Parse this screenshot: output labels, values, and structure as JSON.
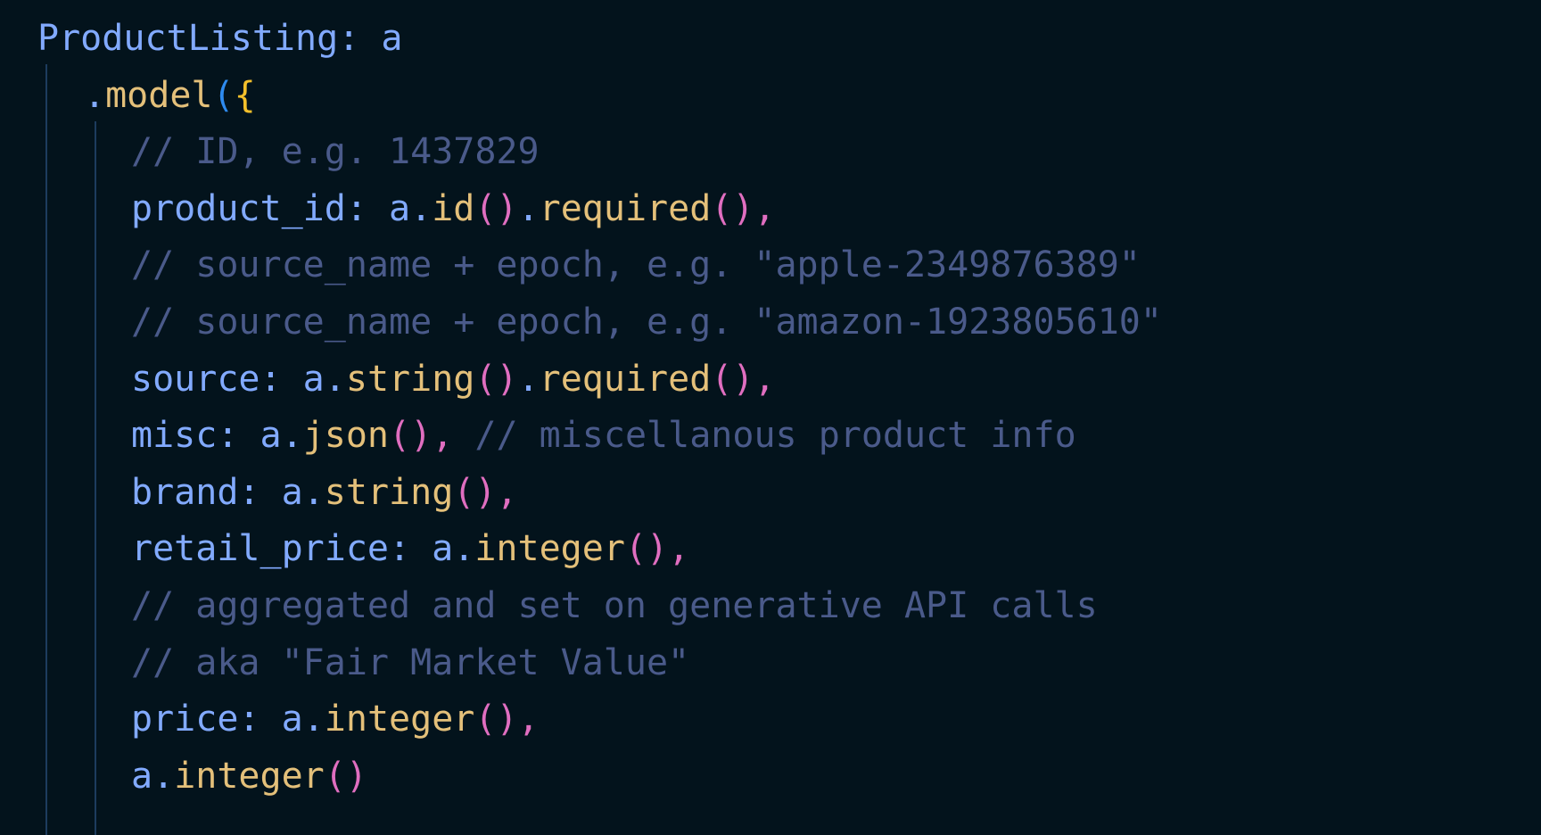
{
  "editor": {
    "language": "typescript",
    "theme_name": "dark-midnight",
    "background_color": "#03131c",
    "indent_guide_color": "#1d3c5e",
    "font_size_px": 40
  },
  "colors": {
    "identifier": "#82aaff",
    "method": "#e4c07a",
    "paren_depth1": "#e06ec0",
    "paren_depth0": "#2e8bf0",
    "brace": "#f5c02b",
    "comment": "#4a5a8a"
  },
  "code": {
    "lines": [
      {
        "indent": 0,
        "tokens": [
          {
            "t": "ProductListing",
            "c": "ident"
          },
          {
            "t": ": ",
            "c": "punct"
          },
          {
            "t": "a",
            "c": "ident"
          }
        ]
      },
      {
        "indent": 1,
        "tokens": [
          {
            "t": ".",
            "c": "dot"
          },
          {
            "t": "model",
            "c": "method"
          },
          {
            "t": "(",
            "c": "paren2"
          },
          {
            "t": "{",
            "c": "brace"
          }
        ]
      },
      {
        "indent": 2,
        "tokens": [
          {
            "t": "// ID, e.g. 1437829",
            "c": "comment"
          }
        ]
      },
      {
        "indent": 2,
        "tokens": [
          {
            "t": "product_id",
            "c": "ident"
          },
          {
            "t": ": ",
            "c": "punct"
          },
          {
            "t": "a",
            "c": "ident"
          },
          {
            "t": ".",
            "c": "dot"
          },
          {
            "t": "id",
            "c": "method"
          },
          {
            "t": "()",
            "c": "paren"
          },
          {
            "t": ".",
            "c": "dot"
          },
          {
            "t": "required",
            "c": "method"
          },
          {
            "t": "()",
            "c": "paren"
          },
          {
            "t": ",",
            "c": "comma"
          }
        ]
      },
      {
        "indent": 2,
        "tokens": [
          {
            "t": "// source_name + epoch, e.g. \"apple-2349876389\"",
            "c": "comment"
          }
        ]
      },
      {
        "indent": 2,
        "tokens": [
          {
            "t": "// source_name + epoch, e.g. \"amazon-1923805610\"",
            "c": "comment"
          }
        ]
      },
      {
        "indent": 2,
        "tokens": [
          {
            "t": "source",
            "c": "ident"
          },
          {
            "t": ": ",
            "c": "punct"
          },
          {
            "t": "a",
            "c": "ident"
          },
          {
            "t": ".",
            "c": "dot"
          },
          {
            "t": "string",
            "c": "method"
          },
          {
            "t": "()",
            "c": "paren"
          },
          {
            "t": ".",
            "c": "dot"
          },
          {
            "t": "required",
            "c": "method"
          },
          {
            "t": "()",
            "c": "paren"
          },
          {
            "t": ",",
            "c": "comma"
          }
        ]
      },
      {
        "indent": 2,
        "tokens": [
          {
            "t": "misc",
            "c": "ident"
          },
          {
            "t": ": ",
            "c": "punct"
          },
          {
            "t": "a",
            "c": "ident"
          },
          {
            "t": ".",
            "c": "dot"
          },
          {
            "t": "json",
            "c": "method"
          },
          {
            "t": "()",
            "c": "paren"
          },
          {
            "t": ",",
            "c": "comma"
          },
          {
            "t": " ",
            "c": "punct"
          },
          {
            "t": "// miscellanous product info",
            "c": "comment"
          }
        ]
      },
      {
        "indent": 2,
        "tokens": [
          {
            "t": "brand",
            "c": "ident"
          },
          {
            "t": ": ",
            "c": "punct"
          },
          {
            "t": "a",
            "c": "ident"
          },
          {
            "t": ".",
            "c": "dot"
          },
          {
            "t": "string",
            "c": "method"
          },
          {
            "t": "()",
            "c": "paren"
          },
          {
            "t": ",",
            "c": "comma"
          }
        ]
      },
      {
        "indent": 2,
        "tokens": [
          {
            "t": "retail_price",
            "c": "ident"
          },
          {
            "t": ": ",
            "c": "punct"
          },
          {
            "t": "a",
            "c": "ident"
          },
          {
            "t": ".",
            "c": "dot"
          },
          {
            "t": "integer",
            "c": "method"
          },
          {
            "t": "()",
            "c": "paren"
          },
          {
            "t": ",",
            "c": "comma"
          }
        ]
      },
      {
        "indent": 2,
        "tokens": [
          {
            "t": "// aggregated and set on generative API calls",
            "c": "comment"
          }
        ]
      },
      {
        "indent": 2,
        "tokens": [
          {
            "t": "// aka \"Fair Market Value\"",
            "c": "comment"
          }
        ]
      },
      {
        "indent": 2,
        "tokens": [
          {
            "t": "price",
            "c": "ident"
          },
          {
            "t": ": ",
            "c": "punct"
          },
          {
            "t": "a",
            "c": "ident"
          },
          {
            "t": ".",
            "c": "dot"
          },
          {
            "t": "integer",
            "c": "method"
          },
          {
            "t": "()",
            "c": "paren"
          },
          {
            "t": ",",
            "c": "comma"
          }
        ]
      },
      {
        "indent": 2,
        "clipped": true,
        "tokens": [
          {
            "t": "a",
            "c": "ident"
          },
          {
            "t": ".",
            "c": "dot"
          },
          {
            "t": "integer",
            "c": "method"
          },
          {
            "t": "()",
            "c": "paren"
          }
        ]
      }
    ]
  }
}
